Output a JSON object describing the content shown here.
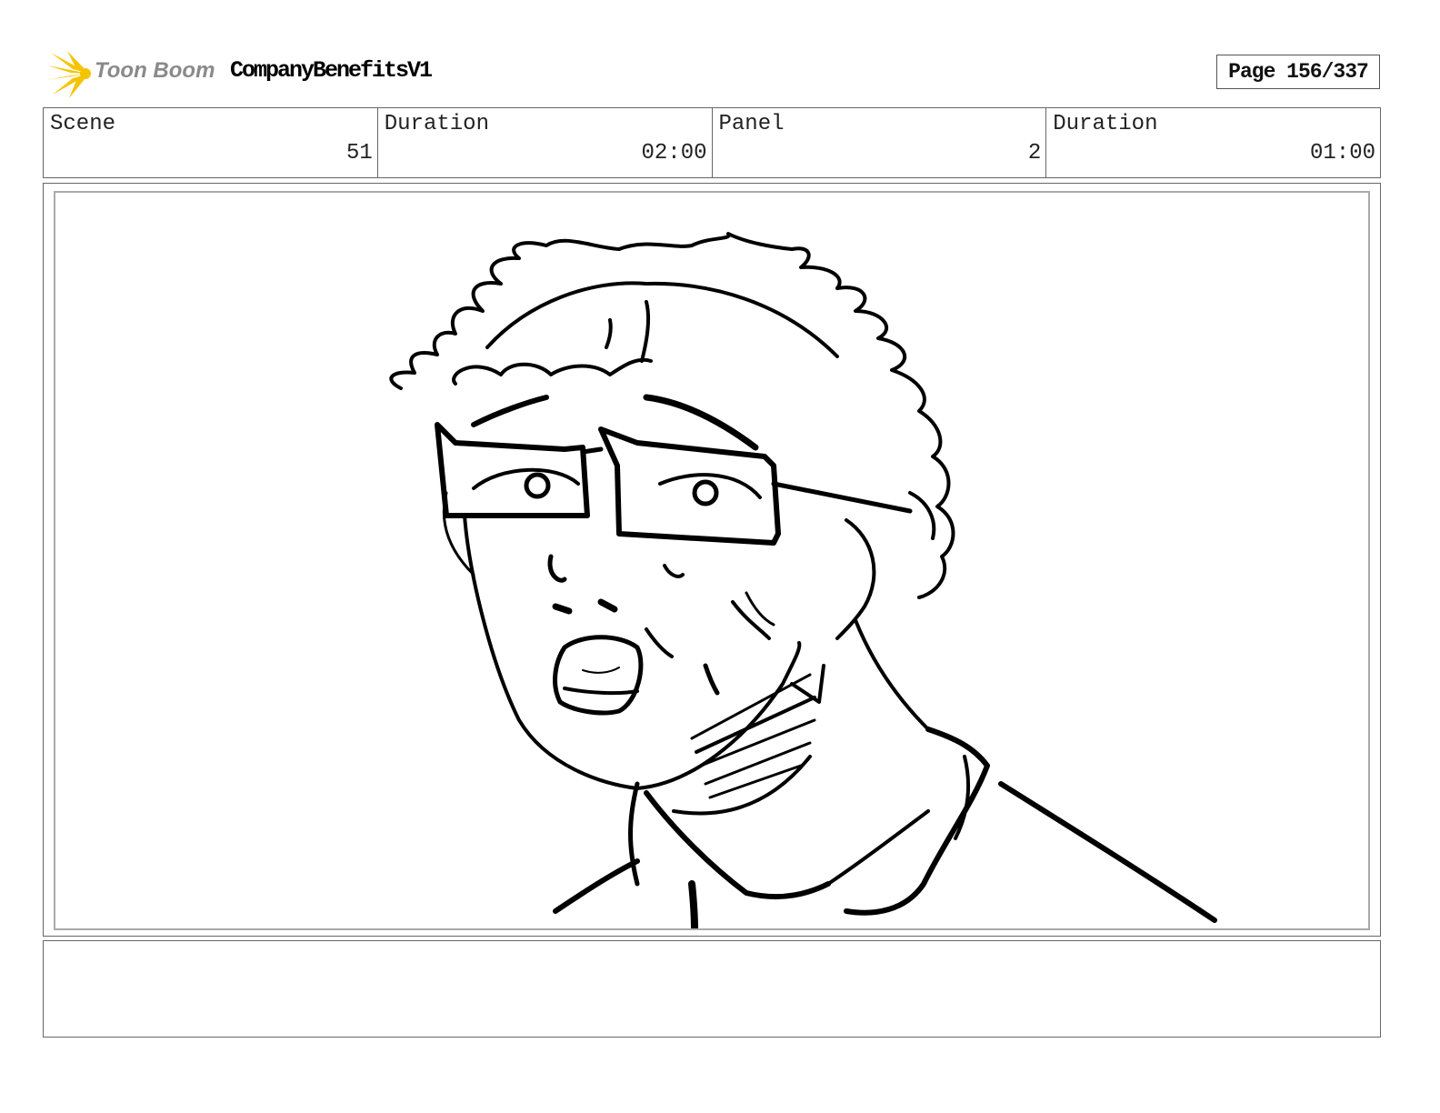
{
  "header": {
    "logo_text": "Toon Boom",
    "project_title": "CompanyBenefitsV1",
    "page_label": "Page 156/337"
  },
  "info": {
    "scene_label": "Scene",
    "scene_value": "51",
    "scene_duration_label": "Duration",
    "scene_duration_value": "02:00",
    "panel_label": "Panel",
    "panel_value": "2",
    "panel_duration_label": "Duration",
    "panel_duration_value": "01:00"
  },
  "panel": {
    "image_icon": "sketch-image"
  },
  "notes": {
    "text": ""
  }
}
